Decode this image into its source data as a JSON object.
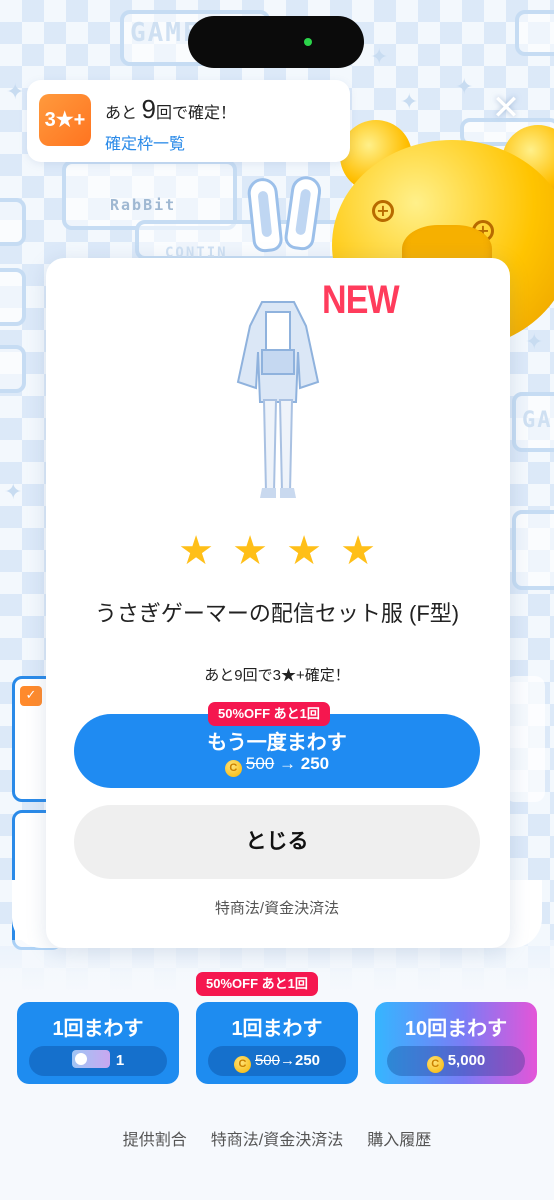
{
  "banner": {
    "badge": "3★+",
    "remain_prefix": "あと",
    "remain_count": "9",
    "remain_suffix": "回で確定！",
    "link": "確定枠一覧"
  },
  "background": {
    "text_1": "GAME",
    "text_2": "RabBit",
    "text_3": "CONTIN",
    "text_4": "GA"
  },
  "modal": {
    "new_label": "NEW",
    "star_count": 4,
    "star_glyph": "★",
    "item_name": "うさぎゲーマーの配信セット服 (F型)",
    "guarantee_text": "あと9回で3★+確定！",
    "discount_tag": "50%OFF あと1回",
    "spin_again_label": "もう一度まわす",
    "spin_again_old_price": "500",
    "spin_again_arrow": "→",
    "spin_again_new_price": "250",
    "close_label": "とじる",
    "law_link": "特商法/資金決済法"
  },
  "spin_buttons": {
    "discount_tag": "50%OFF あと1回",
    "ticket": {
      "label": "1回まわす",
      "count": "1"
    },
    "single": {
      "label": "1回まわす",
      "old_price": "500",
      "arrow": "→",
      "new_price": "250"
    },
    "ten": {
      "label": "10回まわす",
      "price": "5,000"
    }
  },
  "footer": {
    "rates": "提供割合",
    "law": "特商法/資金決済法",
    "history": "購入履歴"
  },
  "colors": {
    "accent_blue": "#1f8bf2",
    "tag_red": "#f5174f",
    "new_red": "#ff3c5c",
    "star_gold": "#ffbf18",
    "badge_orange": "#ff8a2c"
  }
}
